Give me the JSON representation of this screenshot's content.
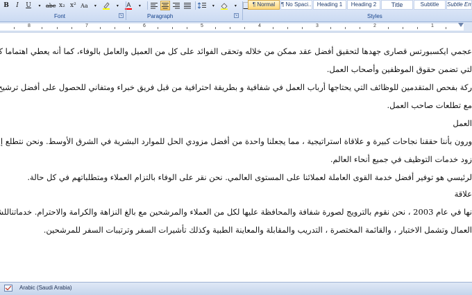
{
  "ribbon": {
    "format_buttons": [
      {
        "label": "B",
        "name": "bold-button"
      },
      {
        "label": "I",
        "name": "italic-button"
      },
      {
        "label": "U",
        "name": "underline-button"
      },
      {
        "label": "abc",
        "name": "strikethrough-button"
      },
      {
        "label": "x₂",
        "name": "subscript-button"
      },
      {
        "label": "x²",
        "name": "superscript-button"
      },
      {
        "label": "Aa",
        "name": "change-case-button"
      }
    ],
    "font_group_label": "Font",
    "paragraph_group_label": "Paragraph",
    "styles_group_label": "Styles",
    "styles": [
      "¶ Normal",
      "¶ No Spaci...",
      "Heading 1",
      "Heading 2",
      "Title",
      "Subtitle",
      "Subtle Em"
    ]
  },
  "ruler": {
    "numbers": [
      "8",
      "7",
      "6",
      "5",
      "4",
      "3",
      "2",
      "1"
    ]
  },
  "document": {
    "lines": [
      "عجمي ايكسبورتس قصارى جهدها لتحقيق أفضل عقد ممكن من خلاله وتحقى الفوائد على كل من العميل والعامل بالوفاء، كما أنه يعطي اهتماما كبيرا لاحترام اتفاقيات",
      "لتي تضمن حقوق الموظفين وأصحاب العمل.",
      "ركة بفحص المتقدمين للوظائف التي يحتاجها أرباب العمل في شفافية  و بطريقة احترافية من قبل فريق خبراء ومتفاني للحصول على أفضل ترشيح للقوى العاملة",
      "مع تطلعات صاحب العمل.",
      "العمل",
      "ورون بأننا حققنا نجاحات كبيرة و علاقاة استراتيجية ، مما يجعلنا واحدة من أفضل مزودي الحل للموارد البشرية في الشرق الأوسط. ونحن نتطلع إلى تطوير نظامنا لتكو",
      "زود خدمات التوظيف في جميع أنحاء العالم.",
      "لرئيسي هو توفير أفضل خدمة القوى العاملة لعملائنا على المستوى العالمي. نحن نقر على الوفاء بالتزام العملاء ومتطلباتهم في كل حالة.",
      "علاقة",
      "نها في عام 2003 ، نحن نقوم بالترويج لصورة شفافة والمحافظة عليها لكل من العملاء والمرشحين مع بالغ النزاهة والكرامة والاحترام. خدماتناللشركات والمحلية متطلعا إلى",
      "العمال وتشمل الاختبار ، والقائمة المختصرة ، التدريب والمقابلة والمعاينة الطبية وكذلك تأشيرات السفر وترتيبات السفر للمرشحين."
    ]
  },
  "status_bar": {
    "language": "Arabic (Saudi Arabia)"
  },
  "colors": {
    "highlight": "#ffff00",
    "font_color": "#ff0000",
    "ribbon_label": "#15428b"
  }
}
